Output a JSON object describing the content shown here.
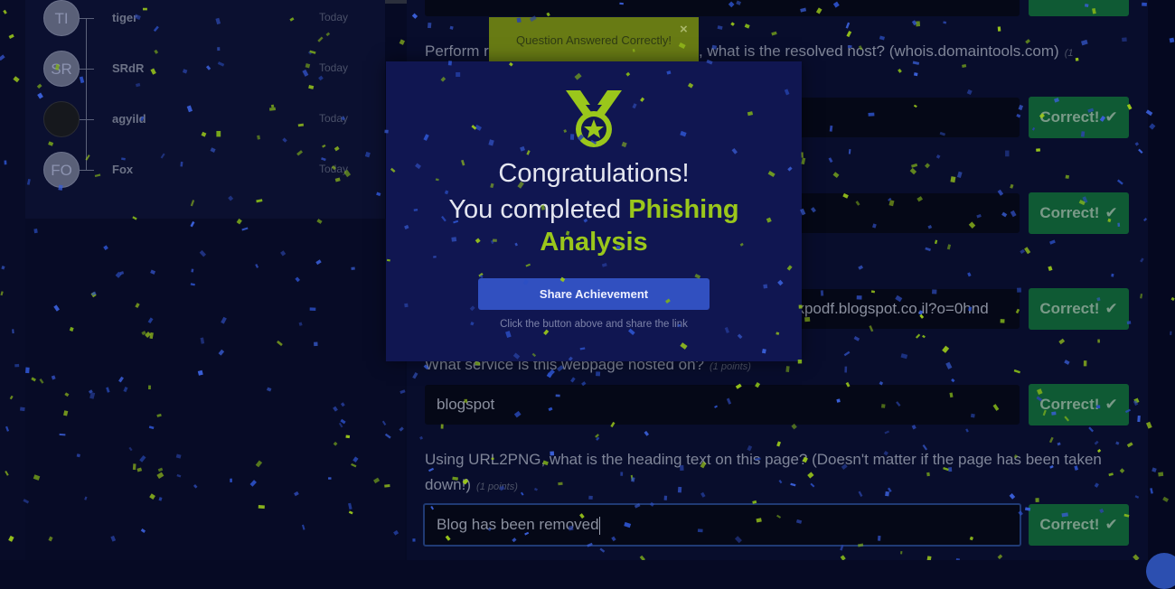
{
  "leaderboard": [
    {
      "initials": "TI",
      "name": "tiger",
      "date": "Today"
    },
    {
      "initials": "SR",
      "name": "SRdR",
      "date": "Today"
    },
    {
      "initials": "",
      "name": "agyild",
      "date": "Today"
    },
    {
      "initials": "FO",
      "name": "Fox",
      "date": "Today"
    }
  ],
  "questions": {
    "q_reverse_dns": {
      "text": "Perform reverse DNS on this IP address, what is the resolved host? (whois.domaintools.com)",
      "points": "(1"
    },
    "q_partial_points": "s)",
    "url_answer_fragment": "ekpodf.blogspot.co.il?o=0hnd",
    "q_service": {
      "text": "What service is this webpage hosted on?",
      "points": "(1 points)",
      "answer": "blogspot"
    },
    "q_heading": {
      "text": "Using URL2PNG, what is the heading text on this page? (Doesn't matter if the page has been taken down!)",
      "points": "(1 points)",
      "answer": "Blog has been removed"
    }
  },
  "correct_button": {
    "label": "Correct!",
    "icon": "check-icon"
  },
  "toast": {
    "message": "Question Answered Correctly!",
    "close": "×"
  },
  "modal": {
    "icon": "medal-icon",
    "line1": "Congratulations!",
    "line2_prefix": "You completed ",
    "room_name_part1": "Phishing",
    "room_name_part2": "Analysis",
    "share_button": "Share Achievement",
    "share_hint": "Click the button above and share the link"
  },
  "colors": {
    "accent_green": "#9ac71b",
    "share_blue": "#3150c0",
    "correct_green": "#0f5a34"
  }
}
